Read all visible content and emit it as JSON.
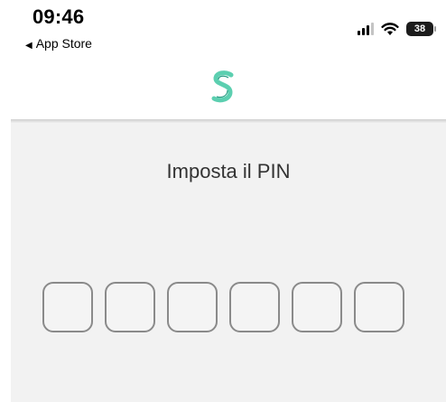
{
  "status_bar": {
    "time": "09:46",
    "back_app": "App Store",
    "battery": "38",
    "icons": [
      "cellular-signal-icon",
      "wifi-icon",
      "battery-icon"
    ]
  },
  "header": {
    "logo": "s-wave-logo",
    "accent_color": "#2bb59a"
  },
  "main": {
    "title": "Imposta il PIN",
    "pin_length": 6,
    "pin_digits": [
      "",
      "",
      "",
      "",
      "",
      ""
    ]
  }
}
